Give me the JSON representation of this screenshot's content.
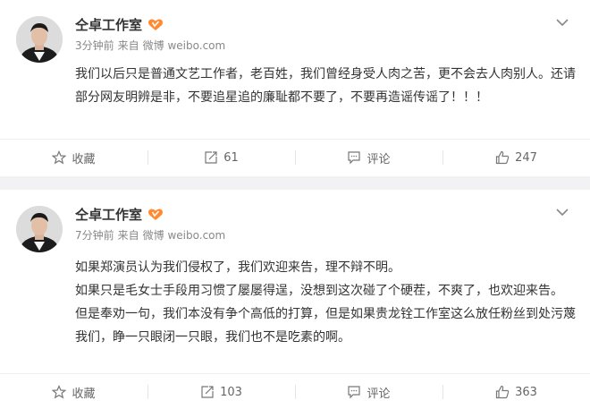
{
  "posts": [
    {
      "author": "仝卓工作室",
      "time": "3分钟前",
      "source_prefix": "来自",
      "source": "微博 weibo.com",
      "paragraphs": [
        "我们以后只是普通文艺工作者，老百姓，我们曾经身受人肉之苦，更不会去人肉别人。还请部分网友明辨是非，不要追星追的廉耻都不要了，不要再造谣传谣了！！！"
      ],
      "actions": {
        "favorite": "收藏",
        "repost": "61",
        "comment": "评论",
        "like": "247"
      }
    },
    {
      "author": "仝卓工作室",
      "time": "7分钟前",
      "source_prefix": "来自",
      "source": "微博 weibo.com",
      "paragraphs": [
        "如果郑演员认为我们侵权了，我们欢迎来告，理不辩不明。",
        "如果只是毛女士手段用习惯了屡屡得逞，没想到这次碰了个硬茬，不爽了，也欢迎来告。",
        "但是奉劝一句，我们本没有争个高低的打算，但是如果贵龙铨工作室这么放任粉丝到处污蔑我们，睁一只眼闭一只眼，我们也不是吃素的啊。"
      ],
      "actions": {
        "favorite": "收藏",
        "repost": "103",
        "comment": "评论",
        "like": "363"
      }
    }
  ],
  "colors": {
    "accent": "#ff8200",
    "text": "#333333",
    "meta": "#888888",
    "background": "#f2f2f5"
  },
  "icons": [
    "avatar",
    "vip-badge-icon",
    "chevron-down-icon",
    "star-icon",
    "repost-icon",
    "comment-icon",
    "thumb-up-icon"
  ]
}
